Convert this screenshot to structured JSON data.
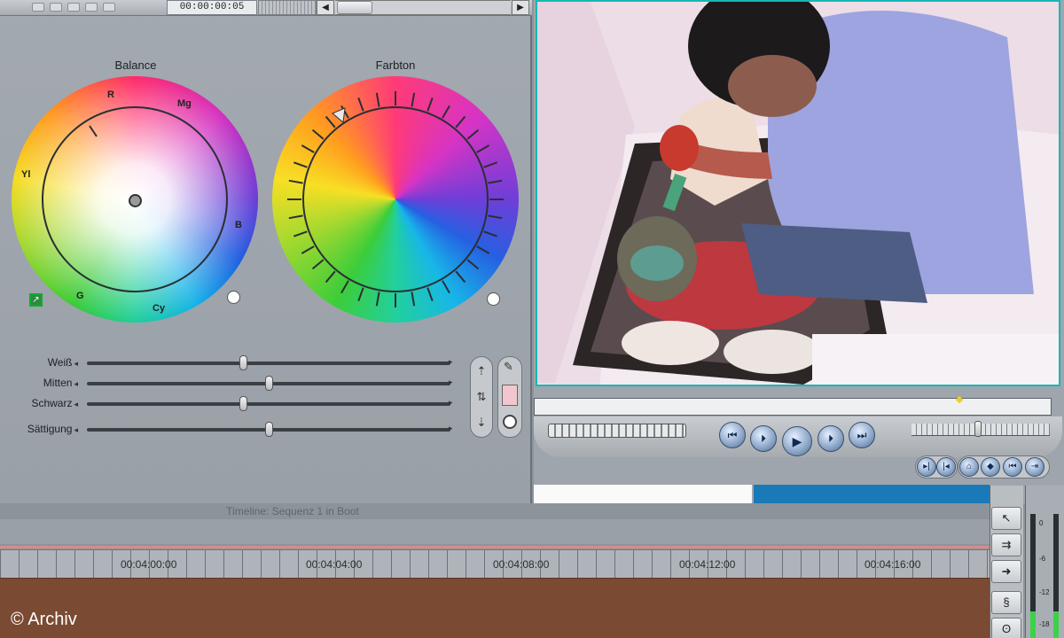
{
  "color_corrector": {
    "timecode": "00:00:00:05",
    "balance_wheel": {
      "title": "Balance",
      "letters": {
        "r": "R",
        "mg": "Mg",
        "b": "B",
        "cy": "Cy",
        "g": "G",
        "yl": "Yl"
      }
    },
    "hue_wheel": {
      "title": "Farbton"
    },
    "sliders": [
      {
        "label": "Weiß",
        "value": 0.43
      },
      {
        "label": "Mitten",
        "value": 0.5
      },
      {
        "label": "Schwarz",
        "value": 0.43
      },
      {
        "label": "Sättigung",
        "value": 0.5
      }
    ]
  },
  "timeline": {
    "title": "Timeline: Sequenz 1 in Boot",
    "ruler_labels": [
      "00:04:00:00",
      "00:04:04:00",
      "00:04:08:00",
      "00:04:12:00",
      "00:04:16:00"
    ]
  },
  "audio_meters": {
    "labels": [
      "0",
      "-6",
      "-12",
      "-18"
    ]
  },
  "credit": "© Archiv",
  "colors": {
    "viewer_border": "#17b8b4",
    "track_clip": "#7a4a32",
    "swatch": "#f3c6cf"
  }
}
